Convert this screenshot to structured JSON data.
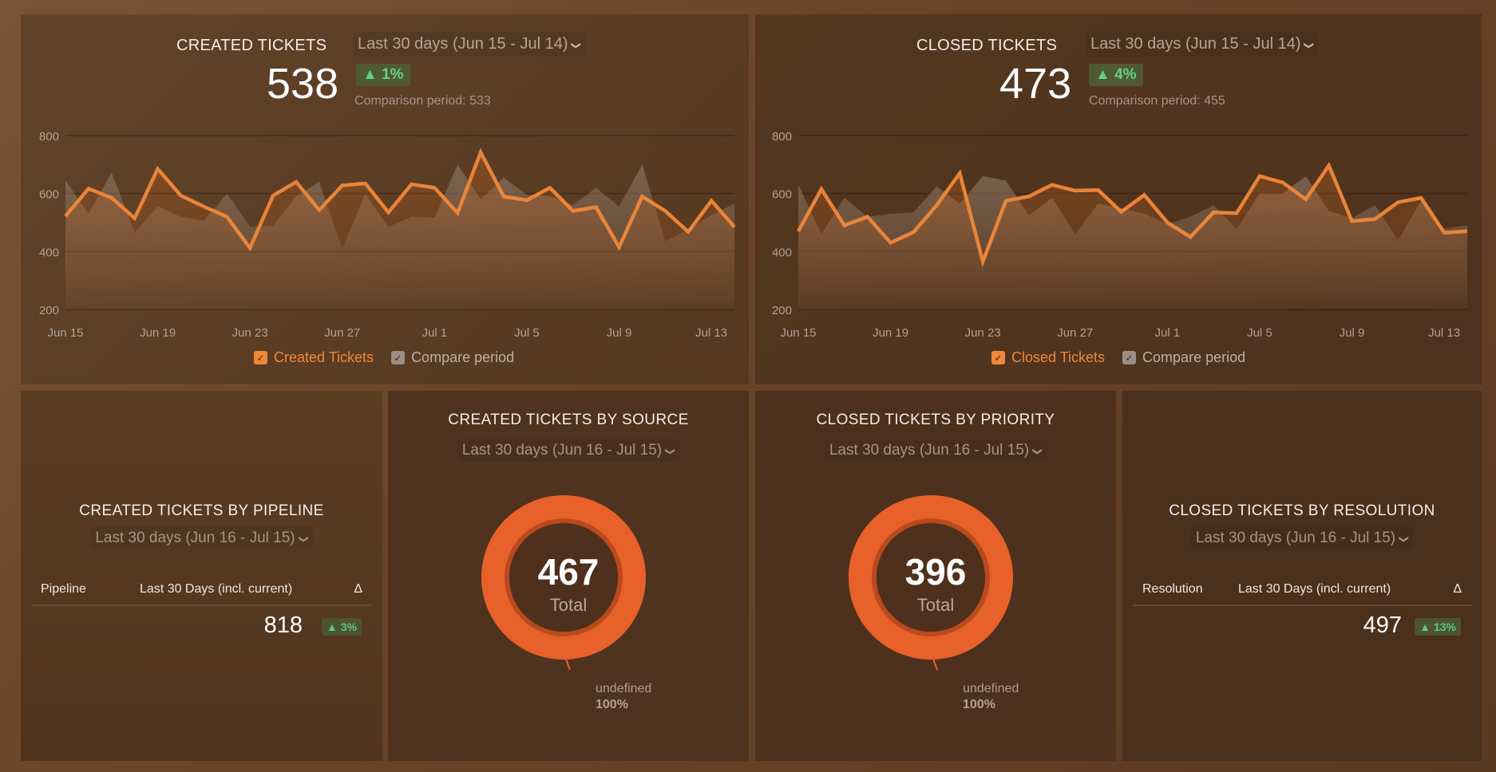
{
  "panels": {
    "created": {
      "title": "CREATED TICKETS",
      "range": "Last 30 days (Jun 15 - Jul 14)",
      "value": "538",
      "delta": "▲ 1%",
      "comparison": "Comparison period: 533",
      "legend": {
        "primary": "Created Tickets",
        "compare": "Compare period"
      }
    },
    "closed": {
      "title": "CLOSED TICKETS",
      "range": "Last 30 days (Jun 15 - Jul 14)",
      "value": "473",
      "delta": "▲ 4%",
      "comparison": "Comparison period: 455",
      "legend": {
        "primary": "Closed Tickets",
        "compare": "Compare period"
      }
    },
    "pipeline": {
      "title": "CREATED TICKETS BY PIPELINE",
      "range": "Last 30 days (Jun 16 - Jul 15)",
      "columns": [
        "Pipeline",
        "Last 30 Days (incl. current)",
        "Δ"
      ],
      "rows": [
        {
          "pipeline": "",
          "value": "818",
          "delta": "▲ 3%"
        }
      ]
    },
    "source": {
      "title": "CREATED TICKETS BY SOURCE",
      "range": "Last 30 days (Jun 16 - Jul 15)",
      "total": "467",
      "total_label": "Total",
      "slice_label": "undefined",
      "slice_pct": "100%"
    },
    "priority": {
      "title": "CLOSED TICKETS BY PRIORITY",
      "range": "Last 30 days (Jun 16 - Jul 15)",
      "total": "396",
      "total_label": "Total",
      "slice_label": "undefined",
      "slice_pct": "100%"
    },
    "resolution": {
      "title": "CLOSED TICKETS BY RESOLUTION",
      "range": "Last 30 days (Jun 16 - Jul 15)",
      "columns": [
        "Resolution",
        "Last 30 Days (incl. current)",
        "Δ"
      ],
      "rows": [
        {
          "resolution": "",
          "value": "497",
          "delta": "▲ 13%"
        }
      ]
    }
  },
  "colors": {
    "primary_line": "#f0883a",
    "compare_area": "#9c8e84",
    "donut": "#e8612a",
    "positive": "#63d08a"
  },
  "chart_data": [
    {
      "type": "line",
      "title": "CREATED TICKETS",
      "ylim": [
        200,
        800
      ],
      "yticks": [
        200,
        400,
        600,
        800
      ],
      "xtick_labels": [
        "Jun 15",
        "Jun 19",
        "Jun 23",
        "Jun 27",
        "Jul 1",
        "Jul 5",
        "Jul 9",
        "Jul 13"
      ],
      "x": [
        "Jun 15",
        "Jun 16",
        "Jun 17",
        "Jun 18",
        "Jun 19",
        "Jun 20",
        "Jun 21",
        "Jun 22",
        "Jun 23",
        "Jun 24",
        "Jun 25",
        "Jun 26",
        "Jun 27",
        "Jun 28",
        "Jun 29",
        "Jun 30",
        "Jul 1",
        "Jul 2",
        "Jul 3",
        "Jul 4",
        "Jul 5",
        "Jul 6",
        "Jul 7",
        "Jul 8",
        "Jul 9",
        "Jul 10",
        "Jul 11",
        "Jul 12",
        "Jul 13",
        "Jul 14"
      ],
      "series": [
        {
          "name": "Created Tickets",
          "values": [
            522,
            617,
            585,
            515,
            685,
            593,
            555,
            520,
            412,
            593,
            640,
            543,
            628,
            635,
            535,
            632,
            620,
            533,
            742,
            590,
            577,
            620,
            540,
            553,
            415,
            590,
            540,
            468,
            575,
            485
          ]
        },
        {
          "name": "Compare period",
          "values": [
            645,
            530,
            672,
            465,
            555,
            520,
            505,
            600,
            485,
            488,
            590,
            640,
            410,
            598,
            485,
            520,
            516,
            700,
            580,
            655,
            595,
            590,
            560,
            620,
            555,
            700,
            435,
            475,
            525,
            565
          ]
        }
      ],
      "grid": true,
      "legend": "bottom"
    },
    {
      "type": "line",
      "title": "CLOSED TICKETS",
      "ylim": [
        200,
        800
      ],
      "yticks": [
        200,
        400,
        600,
        800
      ],
      "xtick_labels": [
        "Jun 15",
        "Jun 19",
        "Jun 23",
        "Jun 27",
        "Jul 1",
        "Jul 5",
        "Jul 9",
        "Jul 13"
      ],
      "x": [
        "Jun 15",
        "Jun 16",
        "Jun 17",
        "Jun 18",
        "Jun 19",
        "Jun 20",
        "Jun 21",
        "Jun 22",
        "Jun 23",
        "Jun 24",
        "Jun 25",
        "Jun 26",
        "Jun 27",
        "Jun 28",
        "Jun 29",
        "Jun 30",
        "Jul 1",
        "Jul 2",
        "Jul 3",
        "Jul 4",
        "Jul 5",
        "Jul 6",
        "Jul 7",
        "Jul 8",
        "Jul 9",
        "Jul 10",
        "Jul 11",
        "Jul 12",
        "Jul 13",
        "Jul 14"
      ],
      "series": [
        {
          "name": "Closed Tickets",
          "values": [
            470,
            615,
            490,
            520,
            430,
            467,
            560,
            670,
            365,
            575,
            590,
            630,
            610,
            612,
            537,
            595,
            500,
            450,
            535,
            532,
            660,
            638,
            580,
            697,
            505,
            512,
            570,
            585,
            465,
            470
          ]
        },
        {
          "name": "Compare period",
          "values": [
            630,
            460,
            585,
            520,
            530,
            535,
            625,
            565,
            660,
            645,
            525,
            585,
            460,
            565,
            550,
            530,
            495,
            520,
            560,
            478,
            600,
            600,
            660,
            540,
            515,
            560,
            440,
            575,
            480,
            490
          ]
        }
      ],
      "grid": true,
      "legend": "bottom"
    },
    {
      "type": "pie",
      "title": "CREATED TICKETS BY SOURCE",
      "categories": [
        "undefined"
      ],
      "values": [
        100
      ],
      "total": 467
    },
    {
      "type": "pie",
      "title": "CLOSED TICKETS BY PRIORITY",
      "categories": [
        "undefined"
      ],
      "values": [
        100
      ],
      "total": 396
    }
  ]
}
